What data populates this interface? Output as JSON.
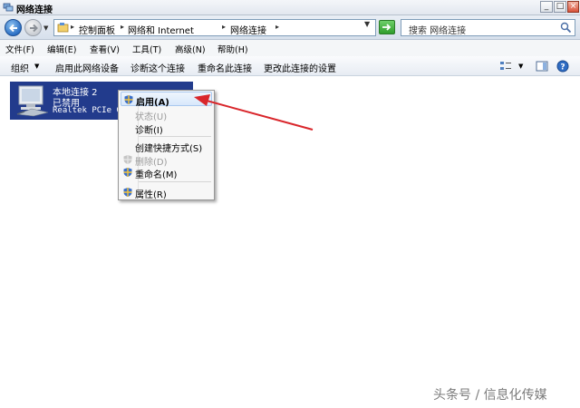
{
  "window": {
    "title": "网络连接",
    "controls": {
      "minimize": "_",
      "maximize": "□",
      "close": "×"
    }
  },
  "address": {
    "crumbs": [
      "控制面板",
      "网络和 Internet",
      "网络连接"
    ],
    "search_placeholder": "搜索 网络连接"
  },
  "menu": {
    "items": [
      "文件(F)",
      "编辑(E)",
      "查看(V)",
      "工具(T)",
      "高级(N)",
      "帮助(H)"
    ]
  },
  "commands": {
    "items": [
      "组织",
      "启用此网络设备",
      "诊断这个连接",
      "重命名此连接",
      "更改此连接的设置"
    ]
  },
  "connection": {
    "name": "本地连接 2",
    "status": "已禁用",
    "adapter": "Realtek PCIe GB"
  },
  "context_menu": {
    "items": [
      {
        "label": "启用(A)",
        "shield": true,
        "bold": true,
        "disabled": false
      },
      {
        "label": "状态(U)",
        "shield": false,
        "bold": false,
        "disabled": true
      },
      {
        "label": "诊断(I)",
        "shield": false,
        "bold": false,
        "disabled": false
      },
      {
        "label": "创建快捷方式(S)",
        "shield": false,
        "bold": false,
        "disabled": false
      },
      {
        "label": "删除(D)",
        "shield": true,
        "bold": false,
        "disabled": true
      },
      {
        "label": "重命名(M)",
        "shield": true,
        "bold": false,
        "disabled": false
      },
      {
        "label": "属性(R)",
        "shield": true,
        "bold": false,
        "disabled": false
      }
    ]
  },
  "annotation": {
    "arrow_color": "#d9262b"
  },
  "watermark": "头条号 / 信息化传媒",
  "colors": {
    "selection": "#223b8c",
    "accent": "#2b6fc4"
  }
}
